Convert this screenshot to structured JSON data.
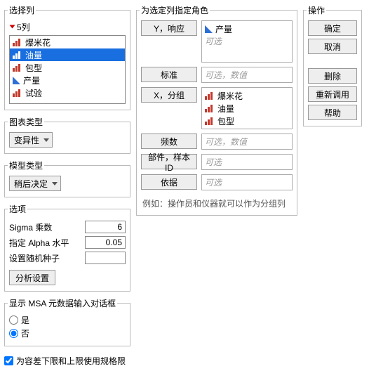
{
  "select_columns": {
    "title": "选择列",
    "header": "5列",
    "items": [
      {
        "label": "爆米花",
        "icon": "bars",
        "selected": false
      },
      {
        "label": "油量",
        "icon": "bars",
        "selected": true
      },
      {
        "label": "包型",
        "icon": "bars",
        "selected": false
      },
      {
        "label": "产量",
        "icon": "tri",
        "selected": false
      },
      {
        "label": "试验",
        "icon": "bars",
        "selected": false
      }
    ]
  },
  "chart_type": {
    "title": "图表类型",
    "value": "变异性"
  },
  "model_type": {
    "title": "模型类型",
    "value": "稍后决定"
  },
  "options": {
    "title": "选项",
    "sigma_label": "Sigma 乘数",
    "sigma_value": "6",
    "alpha_label": "指定 Alpha 水平",
    "alpha_value": "0.05",
    "seed_label": "设置随机种子",
    "seed_value": "",
    "analysis_settings": "分析设置"
  },
  "msa_dialog": {
    "title": "显示 MSA 元数据输入对话框",
    "yes": "是",
    "no": "否",
    "selected": "no"
  },
  "spec_checkbox": {
    "label": "为容差下限和上限使用规格限"
  },
  "roles": {
    "title": "为选定列指定角色",
    "y_btn": "Y，响应",
    "y_items": [
      {
        "label": "产量",
        "icon": "tri"
      }
    ],
    "y_placeholder": "可选",
    "std_btn": "标准",
    "std_placeholder": "可选，数值",
    "x_btn": "X，分组",
    "x_items": [
      {
        "label": "爆米花",
        "icon": "bars"
      },
      {
        "label": "油量",
        "icon": "bars"
      },
      {
        "label": "包型",
        "icon": "bars"
      }
    ],
    "freq_btn": "频数",
    "freq_placeholder": "可选，数值",
    "part_btn": "部件，样本 ID",
    "part_placeholder": "可选",
    "by_btn": "依据",
    "by_placeholder": "可选",
    "hint": "例如：操作员和仪器就可以作为分组列"
  },
  "ops": {
    "title": "操作",
    "ok": "确定",
    "cancel": "取消",
    "remove": "删除",
    "recall": "重新调用",
    "help": "帮助"
  }
}
